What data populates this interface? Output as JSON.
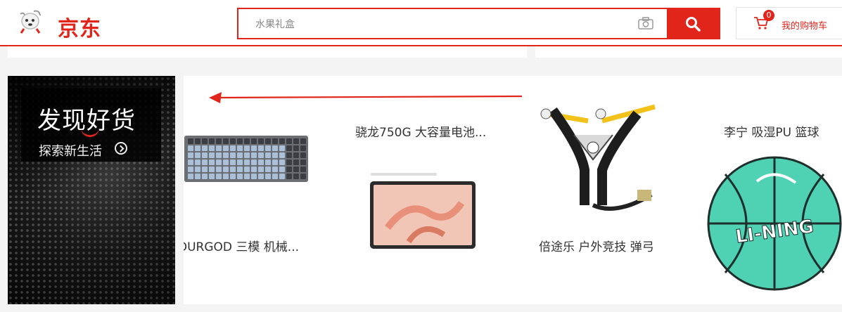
{
  "header": {
    "logo_text": "京东",
    "search_placeholder": "水果礼盒",
    "cart_count": "0",
    "cart_label": "我的购物车"
  },
  "banner": {
    "title": "发现好货",
    "subtitle": "探索新生活"
  },
  "products": [
    {
      "name": "DURGOD 三模 机械...",
      "image": "keyboard"
    },
    {
      "name": "骁龙750G 大容量电池...",
      "image": "tablet"
    },
    {
      "name": "倍途乐 户外竞技 弹弓",
      "image": "slingshot"
    },
    {
      "name": "李宁 吸湿PU 篮球",
      "image": "basketball",
      "ball_text": "LI-NING"
    }
  ],
  "colors": {
    "brand": "#e1251b",
    "ball": "#4fd1b4"
  }
}
